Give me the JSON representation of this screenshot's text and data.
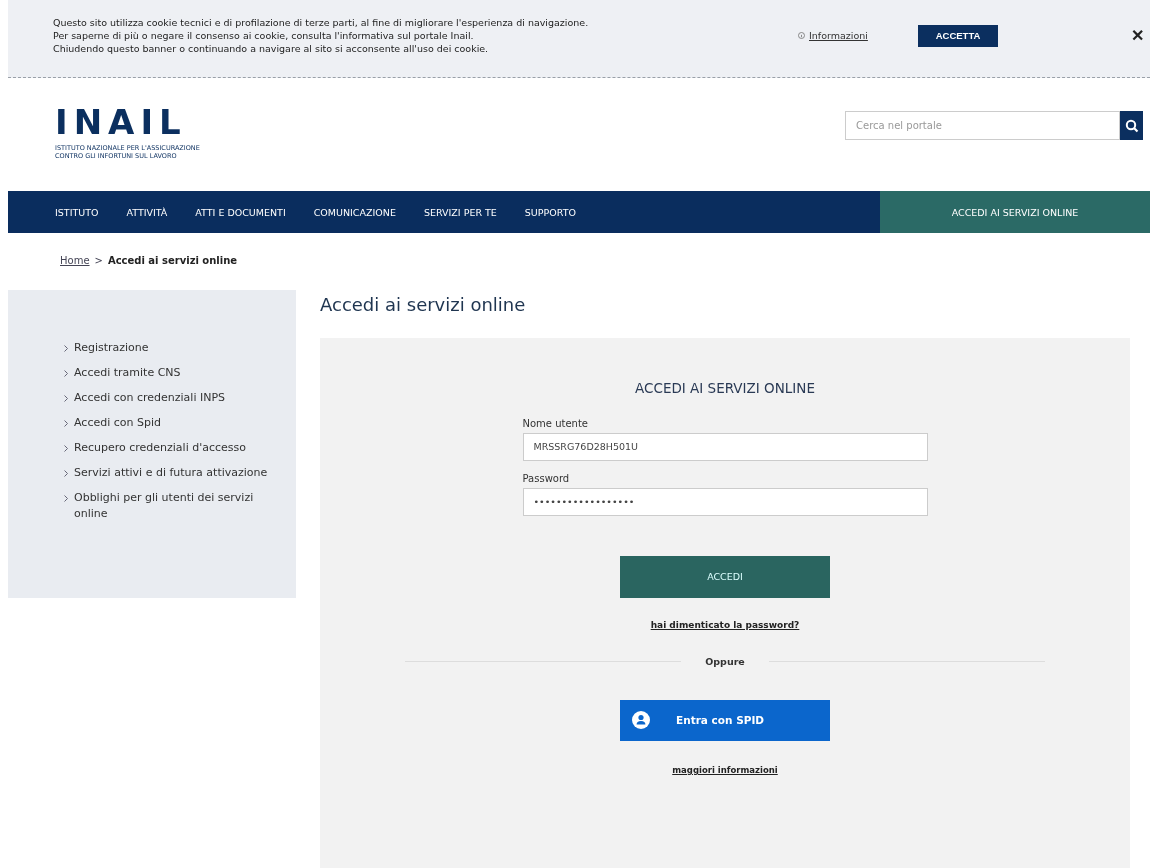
{
  "cookie_banner": {
    "lines": [
      "Questo sito utilizza cookie tecnici e di profilazione di terze parti, al fine di migliorare l'esperienza di navigazione.",
      "Per saperne di più o negare il consenso ai cookie, consulta l'informativa sul portale Inail.",
      "Chiudendo questo banner o continuando a navigare al sito si acconsente all'uso dei cookie."
    ],
    "info_link": "Informazioni",
    "accept_button": "ACCETTA",
    "close": "✕"
  },
  "header": {
    "logo": "INAIL",
    "logo_subtitle": [
      "ISTITUTO NAZIONALE PER L'ASSICURAZIONE",
      "CONTRO GLI INFORTUNI SUL LAVORO"
    ],
    "search": {
      "placeholder": "Cerca nel portale"
    }
  },
  "nav": {
    "items": [
      {
        "label": "ISTITUTO",
        "selected": false
      },
      {
        "label": "ATTIVITÀ",
        "selected": false
      },
      {
        "label": "ATTI E DOCUMENTI",
        "selected": false
      },
      {
        "label": "COMUNICAZIONE",
        "selected": false
      },
      {
        "label": "SERVIZI PER TE",
        "selected": false
      },
      {
        "label": "SUPPORTO",
        "selected": false
      }
    ],
    "highlight": "ACCEDI AI SERVIZI ONLINE"
  },
  "breadcrumb": {
    "items": [
      "Home",
      "Accedi ai servizi online"
    ],
    "separator": ">"
  },
  "sidebar": {
    "items": [
      "Registrazione",
      "Accedi tramite CNS",
      "Accedi con credenziali INPS",
      "Accedi con Spid",
      "Recupero credenziali d'accesso",
      "Servizi attivi e di futura attivazione",
      "Obblighi per gli utenti dei servizi online"
    ]
  },
  "page_title": "Accedi ai servizi online",
  "login_form": {
    "heading": "ACCEDI AI SERVIZI ONLINE",
    "fields": [
      {
        "label": "Nome utente",
        "value": "MRSSRG76D28H501U"
      },
      {
        "label": "Password",
        "value": "••••••••••••••••••"
      }
    ],
    "submit": "ACCEDI",
    "forgot_link": "hai dimenticato la password?",
    "divider": "Oppure",
    "spid_button": "Entra con SPID",
    "more_info": "maggiori informazioni"
  }
}
